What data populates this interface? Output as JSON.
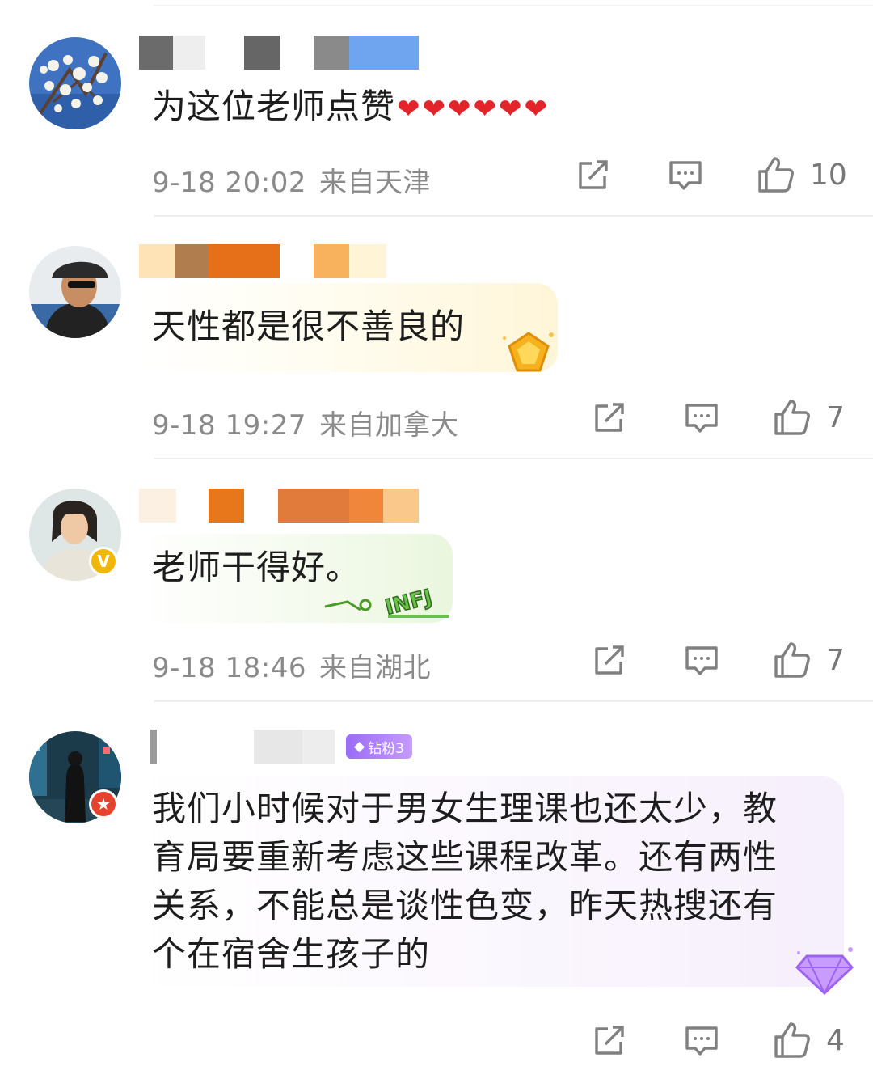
{
  "comments": [
    {
      "text": "为这位老师点赞",
      "hearts": 6,
      "date": "9-18 20:02",
      "location": "来自天津",
      "likes": "10",
      "avatar_icon": "avatar-blossom"
    },
    {
      "text": "天性都是很不善良的",
      "date": "9-18 19:27",
      "location": "来自加拿大",
      "likes": "7",
      "avatar_icon": "avatar-man-sunglasses",
      "decoration_icon": "gold-badge-icon"
    },
    {
      "text": "老师干得好。",
      "date": "9-18 18:46",
      "location": "来自湖北",
      "likes": "7",
      "avatar_icon": "avatar-young-man",
      "verified_badge": "verified-yellow-v-icon",
      "sticker_text": "INFJ"
    },
    {
      "text": "我们小时候对于男女生理课也还太少，教育局要重新考虑这些课程改革。还有两性关系，不能总是谈性色变，昨天热搜还有个在宿舍生孩子的",
      "lines": [
        "我们小时候对于男女生理课也还太少，教",
        "育局要重新考虑这些课程改革。还有两性",
        "关系，不能总是谈性色变，昨天热搜还有",
        "个在宿舍生孩子的"
      ],
      "likes": "4",
      "avatar_icon": "avatar-city-figure",
      "fan_badge": "钻粉3",
      "decoration_icon": "purple-diamond-icon"
    }
  ],
  "colors": {
    "meta_gray": "#8a8a8a",
    "heart_red": "#e3242b",
    "verified_yellow": "#f2b705",
    "fan_badge_purple": "#9b6cf5"
  }
}
